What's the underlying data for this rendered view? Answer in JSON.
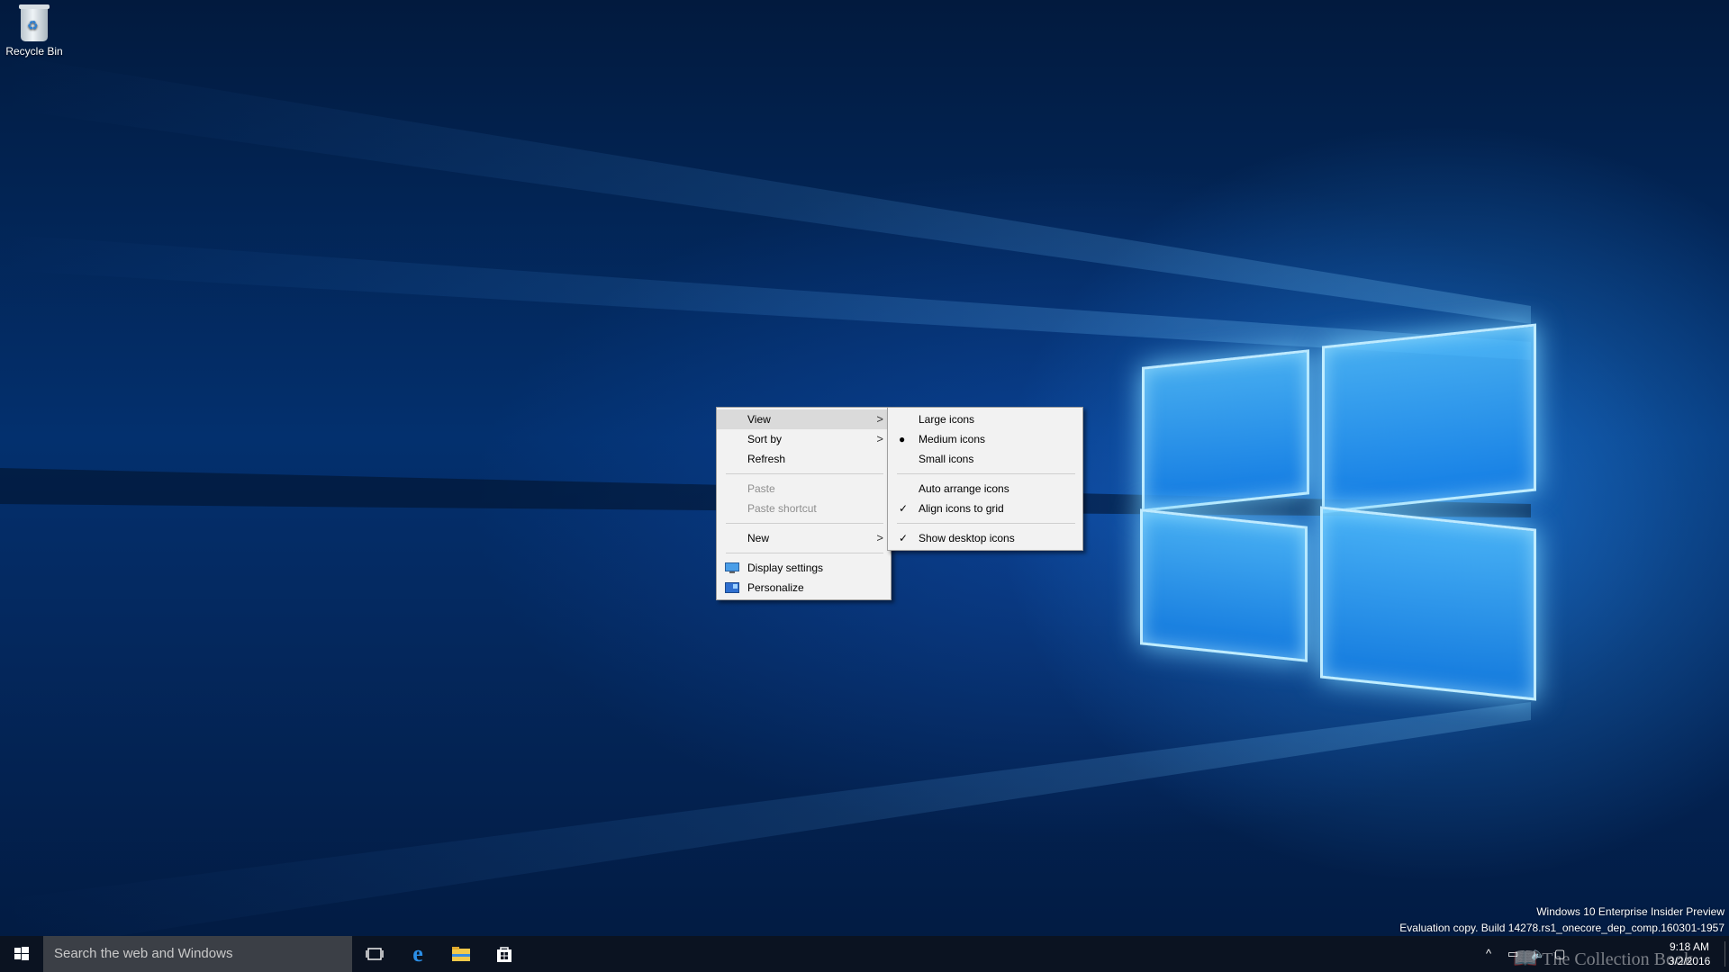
{
  "desktop": {
    "recycle_bin_label": "Recycle Bin"
  },
  "context_menu": {
    "items": [
      {
        "label": "View",
        "has_submenu": true,
        "state": "highlighted"
      },
      {
        "label": "Sort by",
        "has_submenu": true
      },
      {
        "label": "Refresh"
      },
      {
        "label": "Paste",
        "state": "disabled"
      },
      {
        "label": "Paste shortcut",
        "state": "disabled"
      },
      {
        "label": "New",
        "has_submenu": true
      },
      {
        "label": "Display settings",
        "icon": "display-icon"
      },
      {
        "label": "Personalize",
        "icon": "personalize-icon"
      }
    ]
  },
  "view_submenu": {
    "items": [
      {
        "label": "Large icons"
      },
      {
        "label": "Medium icons",
        "marker": "●"
      },
      {
        "label": "Small icons"
      },
      {
        "label": "Auto arrange icons"
      },
      {
        "label": "Align icons to grid",
        "marker": "✓"
      },
      {
        "label": "Show desktop icons",
        "marker": "✓"
      }
    ]
  },
  "watermark": {
    "line1": "Windows 10 Enterprise Insider Preview",
    "line2": "Evaluation copy. Build 14278.rs1_onecore_dep_comp.160301-1957"
  },
  "taskbar": {
    "search_placeholder": "Search the web and Windows",
    "apps": [
      "task-view-icon",
      "edge-icon",
      "file-explorer-icon",
      "store-icon"
    ],
    "clock": {
      "time": "9:18 AM",
      "date": "3/2/2016"
    }
  },
  "overlay_text": "The Collection Book",
  "colors": {
    "menu_bg": "#f2f2f2",
    "menu_highlight": "#dadada",
    "taskbar_bg": "#0c121e",
    "search_bg": "#3b3f46"
  }
}
